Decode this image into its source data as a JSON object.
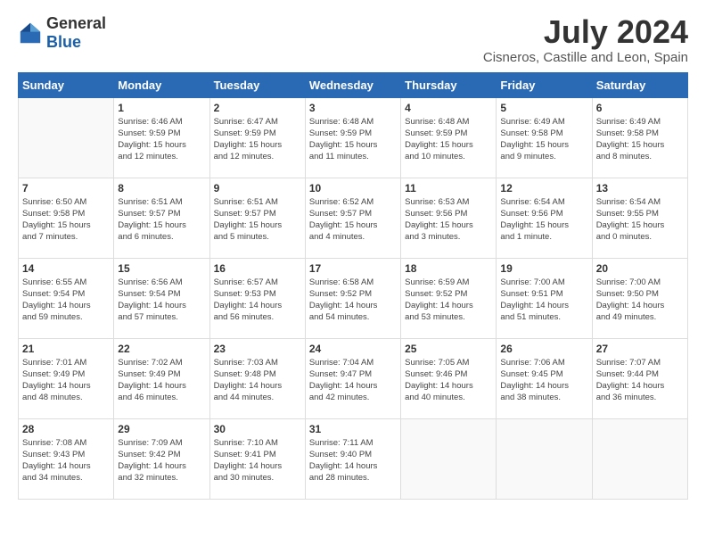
{
  "logo": {
    "general": "General",
    "blue": "Blue"
  },
  "title": "July 2024",
  "location": "Cisneros, Castille and Leon, Spain",
  "days_header": [
    "Sunday",
    "Monday",
    "Tuesday",
    "Wednesday",
    "Thursday",
    "Friday",
    "Saturday"
  ],
  "weeks": [
    [
      {
        "day": "",
        "info": ""
      },
      {
        "day": "1",
        "info": "Sunrise: 6:46 AM\nSunset: 9:59 PM\nDaylight: 15 hours\nand 12 minutes."
      },
      {
        "day": "2",
        "info": "Sunrise: 6:47 AM\nSunset: 9:59 PM\nDaylight: 15 hours\nand 12 minutes."
      },
      {
        "day": "3",
        "info": "Sunrise: 6:48 AM\nSunset: 9:59 PM\nDaylight: 15 hours\nand 11 minutes."
      },
      {
        "day": "4",
        "info": "Sunrise: 6:48 AM\nSunset: 9:59 PM\nDaylight: 15 hours\nand 10 minutes."
      },
      {
        "day": "5",
        "info": "Sunrise: 6:49 AM\nSunset: 9:58 PM\nDaylight: 15 hours\nand 9 minutes."
      },
      {
        "day": "6",
        "info": "Sunrise: 6:49 AM\nSunset: 9:58 PM\nDaylight: 15 hours\nand 8 minutes."
      }
    ],
    [
      {
        "day": "7",
        "info": "Sunrise: 6:50 AM\nSunset: 9:58 PM\nDaylight: 15 hours\nand 7 minutes."
      },
      {
        "day": "8",
        "info": "Sunrise: 6:51 AM\nSunset: 9:57 PM\nDaylight: 15 hours\nand 6 minutes."
      },
      {
        "day": "9",
        "info": "Sunrise: 6:51 AM\nSunset: 9:57 PM\nDaylight: 15 hours\nand 5 minutes."
      },
      {
        "day": "10",
        "info": "Sunrise: 6:52 AM\nSunset: 9:57 PM\nDaylight: 15 hours\nand 4 minutes."
      },
      {
        "day": "11",
        "info": "Sunrise: 6:53 AM\nSunset: 9:56 PM\nDaylight: 15 hours\nand 3 minutes."
      },
      {
        "day": "12",
        "info": "Sunrise: 6:54 AM\nSunset: 9:56 PM\nDaylight: 15 hours\nand 1 minute."
      },
      {
        "day": "13",
        "info": "Sunrise: 6:54 AM\nSunset: 9:55 PM\nDaylight: 15 hours\nand 0 minutes."
      }
    ],
    [
      {
        "day": "14",
        "info": "Sunrise: 6:55 AM\nSunset: 9:54 PM\nDaylight: 14 hours\nand 59 minutes."
      },
      {
        "day": "15",
        "info": "Sunrise: 6:56 AM\nSunset: 9:54 PM\nDaylight: 14 hours\nand 57 minutes."
      },
      {
        "day": "16",
        "info": "Sunrise: 6:57 AM\nSunset: 9:53 PM\nDaylight: 14 hours\nand 56 minutes."
      },
      {
        "day": "17",
        "info": "Sunrise: 6:58 AM\nSunset: 9:52 PM\nDaylight: 14 hours\nand 54 minutes."
      },
      {
        "day": "18",
        "info": "Sunrise: 6:59 AM\nSunset: 9:52 PM\nDaylight: 14 hours\nand 53 minutes."
      },
      {
        "day": "19",
        "info": "Sunrise: 7:00 AM\nSunset: 9:51 PM\nDaylight: 14 hours\nand 51 minutes."
      },
      {
        "day": "20",
        "info": "Sunrise: 7:00 AM\nSunset: 9:50 PM\nDaylight: 14 hours\nand 49 minutes."
      }
    ],
    [
      {
        "day": "21",
        "info": "Sunrise: 7:01 AM\nSunset: 9:49 PM\nDaylight: 14 hours\nand 48 minutes."
      },
      {
        "day": "22",
        "info": "Sunrise: 7:02 AM\nSunset: 9:49 PM\nDaylight: 14 hours\nand 46 minutes."
      },
      {
        "day": "23",
        "info": "Sunrise: 7:03 AM\nSunset: 9:48 PM\nDaylight: 14 hours\nand 44 minutes."
      },
      {
        "day": "24",
        "info": "Sunrise: 7:04 AM\nSunset: 9:47 PM\nDaylight: 14 hours\nand 42 minutes."
      },
      {
        "day": "25",
        "info": "Sunrise: 7:05 AM\nSunset: 9:46 PM\nDaylight: 14 hours\nand 40 minutes."
      },
      {
        "day": "26",
        "info": "Sunrise: 7:06 AM\nSunset: 9:45 PM\nDaylight: 14 hours\nand 38 minutes."
      },
      {
        "day": "27",
        "info": "Sunrise: 7:07 AM\nSunset: 9:44 PM\nDaylight: 14 hours\nand 36 minutes."
      }
    ],
    [
      {
        "day": "28",
        "info": "Sunrise: 7:08 AM\nSunset: 9:43 PM\nDaylight: 14 hours\nand 34 minutes."
      },
      {
        "day": "29",
        "info": "Sunrise: 7:09 AM\nSunset: 9:42 PM\nDaylight: 14 hours\nand 32 minutes."
      },
      {
        "day": "30",
        "info": "Sunrise: 7:10 AM\nSunset: 9:41 PM\nDaylight: 14 hours\nand 30 minutes."
      },
      {
        "day": "31",
        "info": "Sunrise: 7:11 AM\nSunset: 9:40 PM\nDaylight: 14 hours\nand 28 minutes."
      },
      {
        "day": "",
        "info": ""
      },
      {
        "day": "",
        "info": ""
      },
      {
        "day": "",
        "info": ""
      }
    ]
  ]
}
